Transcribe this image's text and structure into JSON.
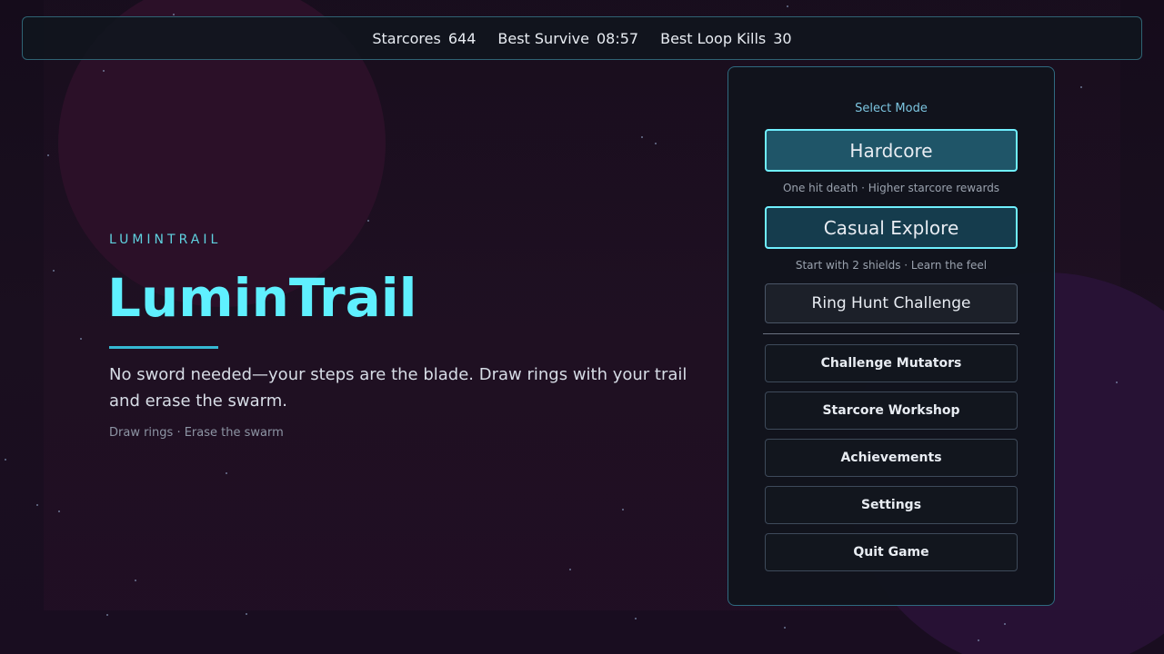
{
  "stats": {
    "starcores_label": "Starcores",
    "starcores_value": "644",
    "best_survive_label": "Best Survive",
    "best_survive_value": "08:57",
    "best_loop_kills_label": "Best Loop Kills",
    "best_loop_kills_value": "30"
  },
  "hero": {
    "eyebrow": "LUMINTRAIL",
    "title": "LuminTrail",
    "tagline": "No sword needed—your steps are the blade. Draw rings with your trail and erase the swarm.",
    "hint": "Draw rings · Erase the swarm"
  },
  "menu": {
    "heading": "Select Mode",
    "modes": [
      {
        "label": "Hardcore",
        "description": "One hit death · Higher starcore rewards"
      },
      {
        "label": "Casual Explore",
        "description": "Start with 2 shields · Learn the feel"
      },
      {
        "label": "Ring Hunt Challenge"
      }
    ],
    "items": [
      {
        "label": "Challenge Mutators"
      },
      {
        "label": "Starcore Workshop"
      },
      {
        "label": "Achievements"
      },
      {
        "label": "Settings"
      },
      {
        "label": "Quit Game"
      }
    ]
  },
  "colors": {
    "accent": "#5ff0ff",
    "panel_border": "#2f6a80",
    "mode_border": "#6ff0ff",
    "hardcore_bg": "#1f5568",
    "casual_bg": "#153c4d",
    "background": "#1a0f1f"
  }
}
